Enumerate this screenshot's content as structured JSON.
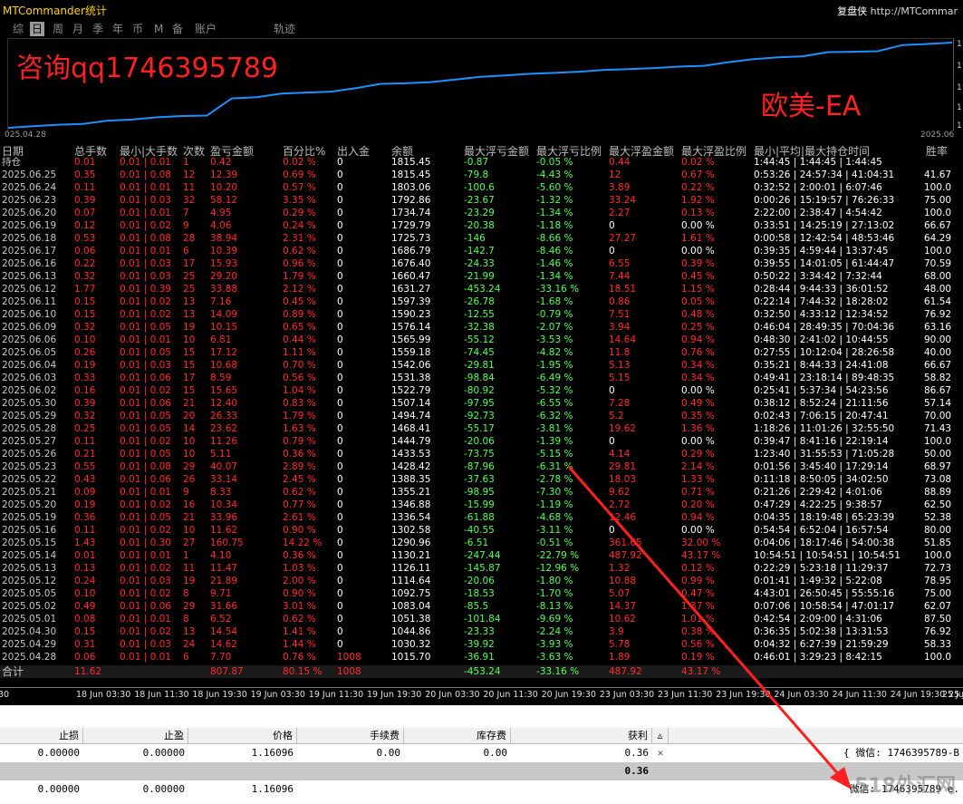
{
  "app_title": "MTCommander统计",
  "brand": {
    "name": "复盘侠",
    "url": "http://MTCommar"
  },
  "tabs": [
    "综",
    "日",
    "周",
    "月",
    "季",
    "年",
    "币",
    "M",
    "备",
    "账户",
    "轨迹"
  ],
  "active_tab": "日",
  "overlay_qq": "咨询qq1746395789",
  "overlay_ea": "欧美-EA",
  "equity": {
    "start_label": "025.04.28",
    "end_label": "2025.06",
    "right_ticks": [
      "1",
      "1",
      "1",
      "1",
      "1"
    ],
    "values": [
      1015.7,
      1030.32,
      1044.86,
      1051.38,
      1083.04,
      1092.75,
      1114.64,
      1126.11,
      1130.21,
      1290.96,
      1302.58,
      1336.54,
      1346.88,
      1355.21,
      1388.35,
      1428.42,
      1433.53,
      1444.79,
      1468.41,
      1494.74,
      1507.14,
      1522.79,
      1531.38,
      1542.06,
      1559.18,
      1565.99,
      1576.14,
      1590.23,
      1597.39,
      1631.27,
      1660.47,
      1676.4,
      1686.79,
      1725.73,
      1729.79,
      1734.74,
      1792.86,
      1803.06,
      1815.45
    ]
  },
  "columns": [
    "日期",
    "总手数",
    "最小|大手数",
    "次数",
    "盈亏金额",
    "百分比%",
    "出入金",
    "余额",
    "最大浮亏金额",
    "最大浮亏比例",
    "最大浮盈金额",
    "最大浮盈比例",
    "最小|平均|最大持仓时间",
    "胜率"
  ],
  "holding_row": {
    "date": "持仓",
    "lot": "0.01",
    "minmax": "0.01 | 0.01",
    "cnt": "1",
    "pnl": "0.42",
    "pct": "0.02 %",
    "io": "0",
    "bal": "1815.45",
    "mfl": "-0.87",
    "mflp": "-0.05 %",
    "mfp": "0.44",
    "mfpp": "0.02 %",
    "time": "1:44:45 | 1:44:45 | 1:44:45",
    "win": ""
  },
  "rows": [
    {
      "date": "2025.06.25",
      "lot": "0.35",
      "minmax": "0.01 | 0.08",
      "cnt": "12",
      "pnl": "12.39",
      "pct": "0.69 %",
      "io": "0",
      "bal": "1815.45",
      "mfl": "-79.8",
      "mflp": "-4.43 %",
      "mfp": "12",
      "mfpp": "0.67 %",
      "time": "0:53:26 | 24:57:34 | 41:04:31",
      "win": "41.67"
    },
    {
      "date": "2025.06.24",
      "lot": "0.11",
      "minmax": "0.01 | 0.01",
      "cnt": "11",
      "pnl": "10.20",
      "pct": "0.57 %",
      "io": "0",
      "bal": "1803.06",
      "mfl": "-100.6",
      "mflp": "-5.60 %",
      "mfp": "3.89",
      "mfpp": "0.22 %",
      "time": "0:32:52 | 2:00:01 | 6:07:46",
      "win": "100.0"
    },
    {
      "date": "2025.06.23",
      "lot": "0.39",
      "minmax": "0.01 | 0.03",
      "cnt": "32",
      "pnl": "58.12",
      "pct": "3.35 %",
      "io": "0",
      "bal": "1792.86",
      "mfl": "-23.67",
      "mflp": "-1.32 %",
      "mfp": "33.24",
      "mfpp": "1.92 %",
      "time": "0:00:26 | 15:19:57 | 76:26:33",
      "win": "75.00"
    },
    {
      "date": "2025.06.20",
      "lot": "0.07",
      "minmax": "0.01 | 0.01",
      "cnt": "7",
      "pnl": "4.95",
      "pct": "0.29 %",
      "io": "0",
      "bal": "1734.74",
      "mfl": "-23.29",
      "mflp": "-1.34 %",
      "mfp": "2.27",
      "mfpp": "0.13 %",
      "time": "2:22:00 | 2:38:47 | 4:54:42",
      "win": "100.0"
    },
    {
      "date": "2025.06.19",
      "lot": "0.12",
      "minmax": "0.01 | 0.02",
      "cnt": "9",
      "pnl": "4.06",
      "pct": "0.24 %",
      "io": "0",
      "bal": "1729.79",
      "mfl": "-20.38",
      "mflp": "-1.18 %",
      "mfp": "0",
      "mfpp": "0.00 %",
      "time": "0:33:51 | 14:25:19 | 27:13:02",
      "win": "66.67"
    },
    {
      "date": "2025.06.18",
      "lot": "0.53",
      "minmax": "0.01 | 0.08",
      "cnt": "28",
      "pnl": "38.94",
      "pct": "2.31 %",
      "io": "0",
      "bal": "1725.73",
      "mfl": "-146",
      "mflp": "-8.66 %",
      "mfp": "27.27",
      "mfpp": "1.61 %",
      "time": "0:00:58 | 12:42:54 | 48:53:46",
      "win": "64.29"
    },
    {
      "date": "2025.06.17",
      "lot": "0.06",
      "minmax": "0.01 | 0.01",
      "cnt": "6",
      "pnl": "10.39",
      "pct": "0.62 %",
      "io": "0",
      "bal": "1686.79",
      "mfl": "-142.7",
      "mflp": "-8.46 %",
      "mfp": "0",
      "mfpp": "0.00 %",
      "time": "0:39:35 | 4:59:44 | 13:37:45",
      "win": "100.0"
    },
    {
      "date": "2025.06.16",
      "lot": "0.22",
      "minmax": "0.01 | 0.03",
      "cnt": "17",
      "pnl": "15.93",
      "pct": "0.96 %",
      "io": "0",
      "bal": "1676.40",
      "mfl": "-24.33",
      "mflp": "-1.46 %",
      "mfp": "6.55",
      "mfpp": "0.39 %",
      "time": "0:39:55 | 14:01:05 | 61:44:47",
      "win": "70.59"
    },
    {
      "date": "2025.06.13",
      "lot": "0.32",
      "minmax": "0.01 | 0.03",
      "cnt": "25",
      "pnl": "29.20",
      "pct": "1.79 %",
      "io": "0",
      "bal": "1660.47",
      "mfl": "-21.99",
      "mflp": "-1.34 %",
      "mfp": "7.44",
      "mfpp": "0.45 %",
      "time": "0:50:22 | 3:34:42 | 7:32:44",
      "win": "68.00"
    },
    {
      "date": "2025.06.12",
      "lot": "1.77",
      "minmax": "0.01 | 0.39",
      "cnt": "25",
      "pnl": "33.88",
      "pct": "2.12 %",
      "io": "0",
      "bal": "1631.27",
      "mfl": "-453.24",
      "mflp": "-33.16 %",
      "mfp": "18.51",
      "mfpp": "1.15 %",
      "time": "0:28:44 | 9:44:33 | 36:01:52",
      "win": "48.00"
    },
    {
      "date": "2025.06.11",
      "lot": "0.15",
      "minmax": "0.01 | 0.02",
      "cnt": "13",
      "pnl": "7.16",
      "pct": "0.45 %",
      "io": "0",
      "bal": "1597.39",
      "mfl": "-26.78",
      "mflp": "-1.68 %",
      "mfp": "0.86",
      "mfpp": "0.05 %",
      "time": "0:22:14 | 7:44:32 | 18:28:02",
      "win": "61.54"
    },
    {
      "date": "2025.06.10",
      "lot": "0.15",
      "minmax": "0.01 | 0.02",
      "cnt": "13",
      "pnl": "14.09",
      "pct": "0.89 %",
      "io": "0",
      "bal": "1590.23",
      "mfl": "-12.55",
      "mflp": "-0.79 %",
      "mfp": "7.51",
      "mfpp": "0.48 %",
      "time": "0:32:50 | 4:33:12 | 12:34:52",
      "win": "76.92"
    },
    {
      "date": "2025.06.09",
      "lot": "0.32",
      "minmax": "0.01 | 0.05",
      "cnt": "19",
      "pnl": "10.15",
      "pct": "0.65 %",
      "io": "0",
      "bal": "1576.14",
      "mfl": "-32.38",
      "mflp": "-2.07 %",
      "mfp": "3.94",
      "mfpp": "0.25 %",
      "time": "0:46:04 | 28:49:35 | 70:04:36",
      "win": "63.16"
    },
    {
      "date": "2025.06.06",
      "lot": "0.10",
      "minmax": "0.01 | 0.01",
      "cnt": "10",
      "pnl": "6.81",
      "pct": "0.44 %",
      "io": "0",
      "bal": "1565.99",
      "mfl": "-55.12",
      "mflp": "-3.53 %",
      "mfp": "14.64",
      "mfpp": "0.94 %",
      "time": "0:48:30 | 2:41:02 | 10:44:55",
      "win": "90.00"
    },
    {
      "date": "2025.06.05",
      "lot": "0.26",
      "minmax": "0.01 | 0.05",
      "cnt": "15",
      "pnl": "17.12",
      "pct": "1.11 %",
      "io": "0",
      "bal": "1559.18",
      "mfl": "-74.45",
      "mflp": "-4.82 %",
      "mfp": "11.8",
      "mfpp": "0.76 %",
      "time": "0:27:55 | 10:12:04 | 28:26:58",
      "win": "40.00"
    },
    {
      "date": "2025.06.04",
      "lot": "0.19",
      "minmax": "0.01 | 0.03",
      "cnt": "15",
      "pnl": "10.68",
      "pct": "0.70 %",
      "io": "0",
      "bal": "1542.06",
      "mfl": "-29.81",
      "mflp": "-1.95 %",
      "mfp": "5.13",
      "mfpp": "0.34 %",
      "time": "0:35:21 | 8:44:33 | 24:41:08",
      "win": "66.67"
    },
    {
      "date": "2025.06.03",
      "lot": "0.33",
      "minmax": "0.01 | 0.06",
      "cnt": "17",
      "pnl": "8.59",
      "pct": "0.56 %",
      "io": "0",
      "bal": "1531.38",
      "mfl": "-98.84",
      "mflp": "-6.49 %",
      "mfp": "5.15",
      "mfpp": "0.34 %",
      "time": "0:49:41 | 23:18:14 | 89:48:35",
      "win": "58.82"
    },
    {
      "date": "2025.06.02",
      "lot": "0.16",
      "minmax": "0.01 | 0.02",
      "cnt": "15",
      "pnl": "15.65",
      "pct": "1.04 %",
      "io": "0",
      "bal": "1522.79",
      "mfl": "-80.92",
      "mflp": "-5.32 %",
      "mfp": "0",
      "mfpp": "0.00 %",
      "time": "0:25:41 | 5:37:34 | 54:23:56",
      "win": "86.67"
    },
    {
      "date": "2025.05.30",
      "lot": "0.39",
      "minmax": "0.01 | 0.06",
      "cnt": "21",
      "pnl": "12.40",
      "pct": "0.83 %",
      "io": "0",
      "bal": "1507.14",
      "mfl": "-97.95",
      "mflp": "-6.55 %",
      "mfp": "7.28",
      "mfpp": "0.49 %",
      "time": "0:38:12 | 8:52:24 | 21:11:56",
      "win": "57.14"
    },
    {
      "date": "2025.05.29",
      "lot": "0.32",
      "minmax": "0.01 | 0.05",
      "cnt": "20",
      "pnl": "26.33",
      "pct": "1.79 %",
      "io": "0",
      "bal": "1494.74",
      "mfl": "-92.73",
      "mflp": "-6.32 %",
      "mfp": "5.2",
      "mfpp": "0.35 %",
      "time": "0:02:43 | 7:06:15 | 20:47:41",
      "win": "70.00"
    },
    {
      "date": "2025.05.28",
      "lot": "0.25",
      "minmax": "0.01 | 0.05",
      "cnt": "14",
      "pnl": "23.62",
      "pct": "1.63 %",
      "io": "0",
      "bal": "1468.41",
      "mfl": "-55.17",
      "mflp": "-3.81 %",
      "mfp": "19.62",
      "mfpp": "1.36 %",
      "time": "1:18:26 | 11:01:26 | 32:55:50",
      "win": "71.43"
    },
    {
      "date": "2025.05.27",
      "lot": "0.11",
      "minmax": "0.01 | 0.02",
      "cnt": "10",
      "pnl": "11.26",
      "pct": "0.79 %",
      "io": "0",
      "bal": "1444.79",
      "mfl": "-20.06",
      "mflp": "-1.39 %",
      "mfp": "0",
      "mfpp": "0.00 %",
      "time": "0:39:47 | 8:41:16 | 22:19:14",
      "win": "100.0"
    },
    {
      "date": "2025.05.26",
      "lot": "0.21",
      "minmax": "0.01 | 0.05",
      "cnt": "10",
      "pnl": "5.11",
      "pct": "0.36 %",
      "io": "0",
      "bal": "1433.53",
      "mfl": "-73.75",
      "mflp": "-5.15 %",
      "mfp": "4.14",
      "mfpp": "0.29 %",
      "time": "1:23:40 | 31:55:53 | 71:05:28",
      "win": "50.00"
    },
    {
      "date": "2025.05.23",
      "lot": "0.55",
      "minmax": "0.01 | 0.08",
      "cnt": "29",
      "pnl": "40.07",
      "pct": "2.89 %",
      "io": "0",
      "bal": "1428.42",
      "mfl": "-87.96",
      "mflp": "-6.31 %",
      "mfp": "29.81",
      "mfpp": "2.14 %",
      "time": "0:01:56 | 3:45:40 | 17:29:14",
      "win": "68.97"
    },
    {
      "date": "2025.05.22",
      "lot": "0.43",
      "minmax": "0.01 | 0.06",
      "cnt": "26",
      "pnl": "33.14",
      "pct": "2.45 %",
      "io": "0",
      "bal": "1388.35",
      "mfl": "-37.63",
      "mflp": "-2.78 %",
      "mfp": "18.03",
      "mfpp": "1.33 %",
      "time": "0:11:18 | 8:50:05 | 34:02:50",
      "win": "73.08"
    },
    {
      "date": "2025.05.21",
      "lot": "0.09",
      "minmax": "0.01 | 0.01",
      "cnt": "9",
      "pnl": "8.33",
      "pct": "0.62 %",
      "io": "0",
      "bal": "1355.21",
      "mfl": "-98.95",
      "mflp": "-7.30 %",
      "mfp": "9.62",
      "mfpp": "0.71 %",
      "time": "0:21:26 | 2:29:42 | 4:01:06",
      "win": "88.89"
    },
    {
      "date": "2025.05.20",
      "lot": "0.19",
      "minmax": "0.01 | 0.02",
      "cnt": "16",
      "pnl": "10.34",
      "pct": "0.77 %",
      "io": "0",
      "bal": "1346.88",
      "mfl": "-15.99",
      "mflp": "-1.19 %",
      "mfp": "2.72",
      "mfpp": "0.20 %",
      "time": "0:47:29 | 4:22:25 | 9:38:57",
      "win": "62.50"
    },
    {
      "date": "2025.05.19",
      "lot": "0.36",
      "minmax": "0.01 | 0.05",
      "cnt": "21",
      "pnl": "33.96",
      "pct": "2.61 %",
      "io": "0",
      "bal": "1336.54",
      "mfl": "-61.88",
      "mflp": "-4.68 %",
      "mfp": "12.46",
      "mfpp": "0.94 %",
      "time": "0:04:35 | 18:19:48 | 65:23:39",
      "win": "52.38"
    },
    {
      "date": "2025.05.16",
      "lot": "0.11",
      "minmax": "0.01 | 0.02",
      "cnt": "10",
      "pnl": "11.62",
      "pct": "0.90 %",
      "io": "0",
      "bal": "1302.58",
      "mfl": "-40.55",
      "mflp": "-3.11 %",
      "mfp": "0",
      "mfpp": "0.00 %",
      "time": "0:54:54 | 6:52:04 | 16:57:54",
      "win": "80.00"
    },
    {
      "date": "2025.05.15",
      "lot": "1.43",
      "minmax": "0.01 | 0.30",
      "cnt": "27",
      "pnl": "160.75",
      "pct": "14.22 %",
      "io": "0",
      "bal": "1290.96",
      "mfl": "-6.51",
      "mflp": "-0.51 %",
      "mfp": "361.65",
      "mfpp": "32.00 %",
      "time": "0:04:06 | 18:17:46 | 54:00:38",
      "win": "51.85"
    },
    {
      "date": "2025.05.14",
      "lot": "0.01",
      "minmax": "0.01 | 0.01",
      "cnt": "1",
      "pnl": "4.10",
      "pct": "0.36 %",
      "io": "0",
      "bal": "1130.21",
      "mfl": "-247.44",
      "mflp": "-22.79 %",
      "mfp": "487.92",
      "mfpp": "43.17 %",
      "time": "10:54:51 | 10:54:51 | 10:54:51",
      "win": "100.0"
    },
    {
      "date": "2025.05.13",
      "lot": "0.13",
      "minmax": "0.01 | 0.02",
      "cnt": "11",
      "pnl": "11.47",
      "pct": "1.03 %",
      "io": "0",
      "bal": "1126.11",
      "mfl": "-145.87",
      "mflp": "-12.96 %",
      "mfp": "1.32",
      "mfpp": "0.12 %",
      "time": "0:22:29 | 5:23:18 | 11:29:37",
      "win": "72.73"
    },
    {
      "date": "2025.05.12",
      "lot": "0.24",
      "minmax": "0.01 | 0.03",
      "cnt": "19",
      "pnl": "21.89",
      "pct": "2.00 %",
      "io": "0",
      "bal": "1114.64",
      "mfl": "-20.06",
      "mflp": "-1.80 %",
      "mfp": "10.88",
      "mfpp": "0.99 %",
      "time": "0:01:41 | 1:49:32 | 5:22:08",
      "win": "78.95"
    },
    {
      "date": "2025.05.05",
      "lot": "0.10",
      "minmax": "0.01 | 0.02",
      "cnt": "8",
      "pnl": "9.71",
      "pct": "0.90 %",
      "io": "0",
      "bal": "1092.75",
      "mfl": "-18.53",
      "mflp": "-1.70 %",
      "mfp": "5.07",
      "mfpp": "0.47 %",
      "time": "4:43:01 | 26:50:45 | 55:55:16",
      "win": "75.00"
    },
    {
      "date": "2025.05.02",
      "lot": "0.49",
      "minmax": "0.01 | 0.06",
      "cnt": "29",
      "pnl": "31.66",
      "pct": "3.01 %",
      "io": "0",
      "bal": "1083.04",
      "mfl": "-85.5",
      "mflp": "-8.13 %",
      "mfp": "14.37",
      "mfpp": "1.37 %",
      "time": "0:07:06 | 10:58:54 | 47:01:17",
      "win": "62.07"
    },
    {
      "date": "2025.05.01",
      "lot": "0.08",
      "minmax": "0.01 | 0.01",
      "cnt": "8",
      "pnl": "6.52",
      "pct": "0.62 %",
      "io": "0",
      "bal": "1051.38",
      "mfl": "-101.84",
      "mflp": "-9.69 %",
      "mfp": "10.62",
      "mfpp": "1.01 %",
      "time": "0:42:54 | 2:09:00 | 4:31:06",
      "win": "87.50"
    },
    {
      "date": "2025.04.30",
      "lot": "0.15",
      "minmax": "0.01 | 0.02",
      "cnt": "13",
      "pnl": "14.54",
      "pct": "1.41 %",
      "io": "0",
      "bal": "1044.86",
      "mfl": "-23.33",
      "mflp": "-2.24 %",
      "mfp": "3.9",
      "mfpp": "0.38 %",
      "time": "0:36:35 | 5:02:38 | 13:31:53",
      "win": "76.92"
    },
    {
      "date": "2025.04.29",
      "lot": "0.31",
      "minmax": "0.01 | 0.03",
      "cnt": "24",
      "pnl": "14.62",
      "pct": "1.44 %",
      "io": "0",
      "bal": "1030.32",
      "mfl": "-39.92",
      "mflp": "-3.93 %",
      "mfp": "5.78",
      "mfpp": "0.56 %",
      "time": "0:04:32 | 6:27:39 | 21:59:29",
      "win": "58.33"
    },
    {
      "date": "2025.04.28",
      "lot": "0.06",
      "minmax": "0.01 | 0.01",
      "cnt": "6",
      "pnl": "7.70",
      "pct": "0.76 %",
      "io": "1008",
      "bal": "1015.70",
      "mfl": "-36.91",
      "mflp": "-3.63 %",
      "mfp": "1.89",
      "mfpp": "0.19 %",
      "time": "0:46:01 | 3:29:23 | 8:42:15",
      "win": "100.0"
    }
  ],
  "total_row": {
    "date": "合计",
    "lot": "11.62",
    "minmax": "",
    "cnt": "",
    "pnl": "807.87",
    "pct": "80.15 %",
    "io": "1008",
    "bal": "",
    "mfl": "-453.24",
    "mflp": "-33.16 %",
    "mfp": "487.92",
    "mfpp": "43.17 %",
    "time": "",
    "win": ""
  },
  "time_axis": [
    "30",
    "18 Jun 03:30",
    "18 Jun 11:30",
    "18 Jun 19:30",
    "19 Jun 03:30",
    "19 Jun 11:30",
    "19 Jun 19:30",
    "20 Jun 03:30",
    "20 Jun 11:30",
    "20 Jun 19:30",
    "23 Jun 03:30",
    "23 Jun 11:30",
    "23 Jun 19:30",
    "24 Jun 03:30",
    "24 Jun 11:30",
    "24 Jun 19:30",
    "25 Jun 03:30",
    "25 Jun"
  ],
  "grid": {
    "headers": [
      "止损",
      "止盈",
      "价格",
      "手续费",
      "库存费",
      "获利"
    ],
    "row1": [
      "0.00000",
      "0.00000",
      "1.16096",
      "0.00",
      "0.00",
      "0.36"
    ],
    "row1_comment": "{ 微信: 1746395789-B",
    "sum": "0.36",
    "row2": [
      "0.00000",
      "0.00000",
      "1.16096"
    ],
    "row2_comment": "微信: 1746395789 e."
  },
  "watermark": "518外汇网",
  "colors": {
    "equity_line": "#1e90ff",
    "loss": "#ff2a2a",
    "gain": "#55ff55",
    "arrow": "#ff2020"
  }
}
